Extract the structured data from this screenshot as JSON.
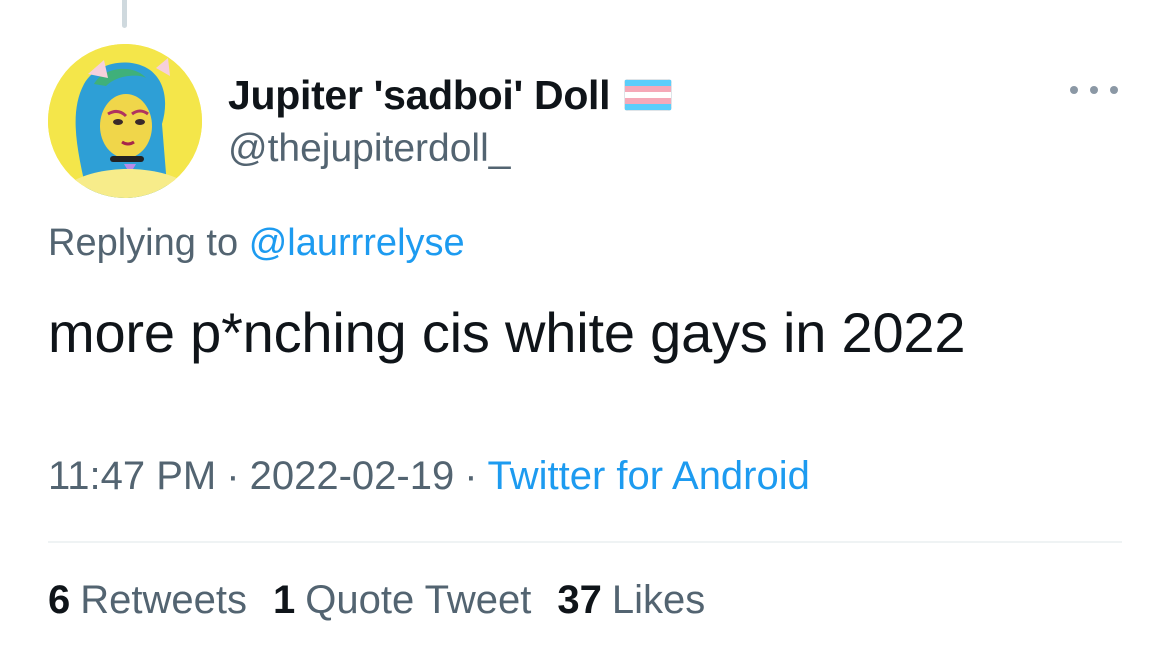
{
  "tweet": {
    "display_name": "Jupiter 'sadboi' Doll",
    "handle": "@thejupiterdoll_",
    "replying_prefix": "Replying to",
    "replying_to": "@laurrrelyse",
    "text": "more p*nching cis white gays in 2022",
    "time": "11:47 PM",
    "separator": "·",
    "date": "2022-02-19",
    "source": "Twitter for Android",
    "flag_icon": "transgender-flag-icon",
    "more_icon": "more-options-icon"
  },
  "stats": [
    {
      "value": "6",
      "label": "Retweets"
    },
    {
      "value": "1",
      "label": "Quote Tweet"
    },
    {
      "value": "37",
      "label": "Likes"
    }
  ],
  "colors": {
    "accent": "#1d9bf0",
    "muted_text": "#536471",
    "primary_text": "#0f1419",
    "avatar_background": "#f4e64a"
  }
}
